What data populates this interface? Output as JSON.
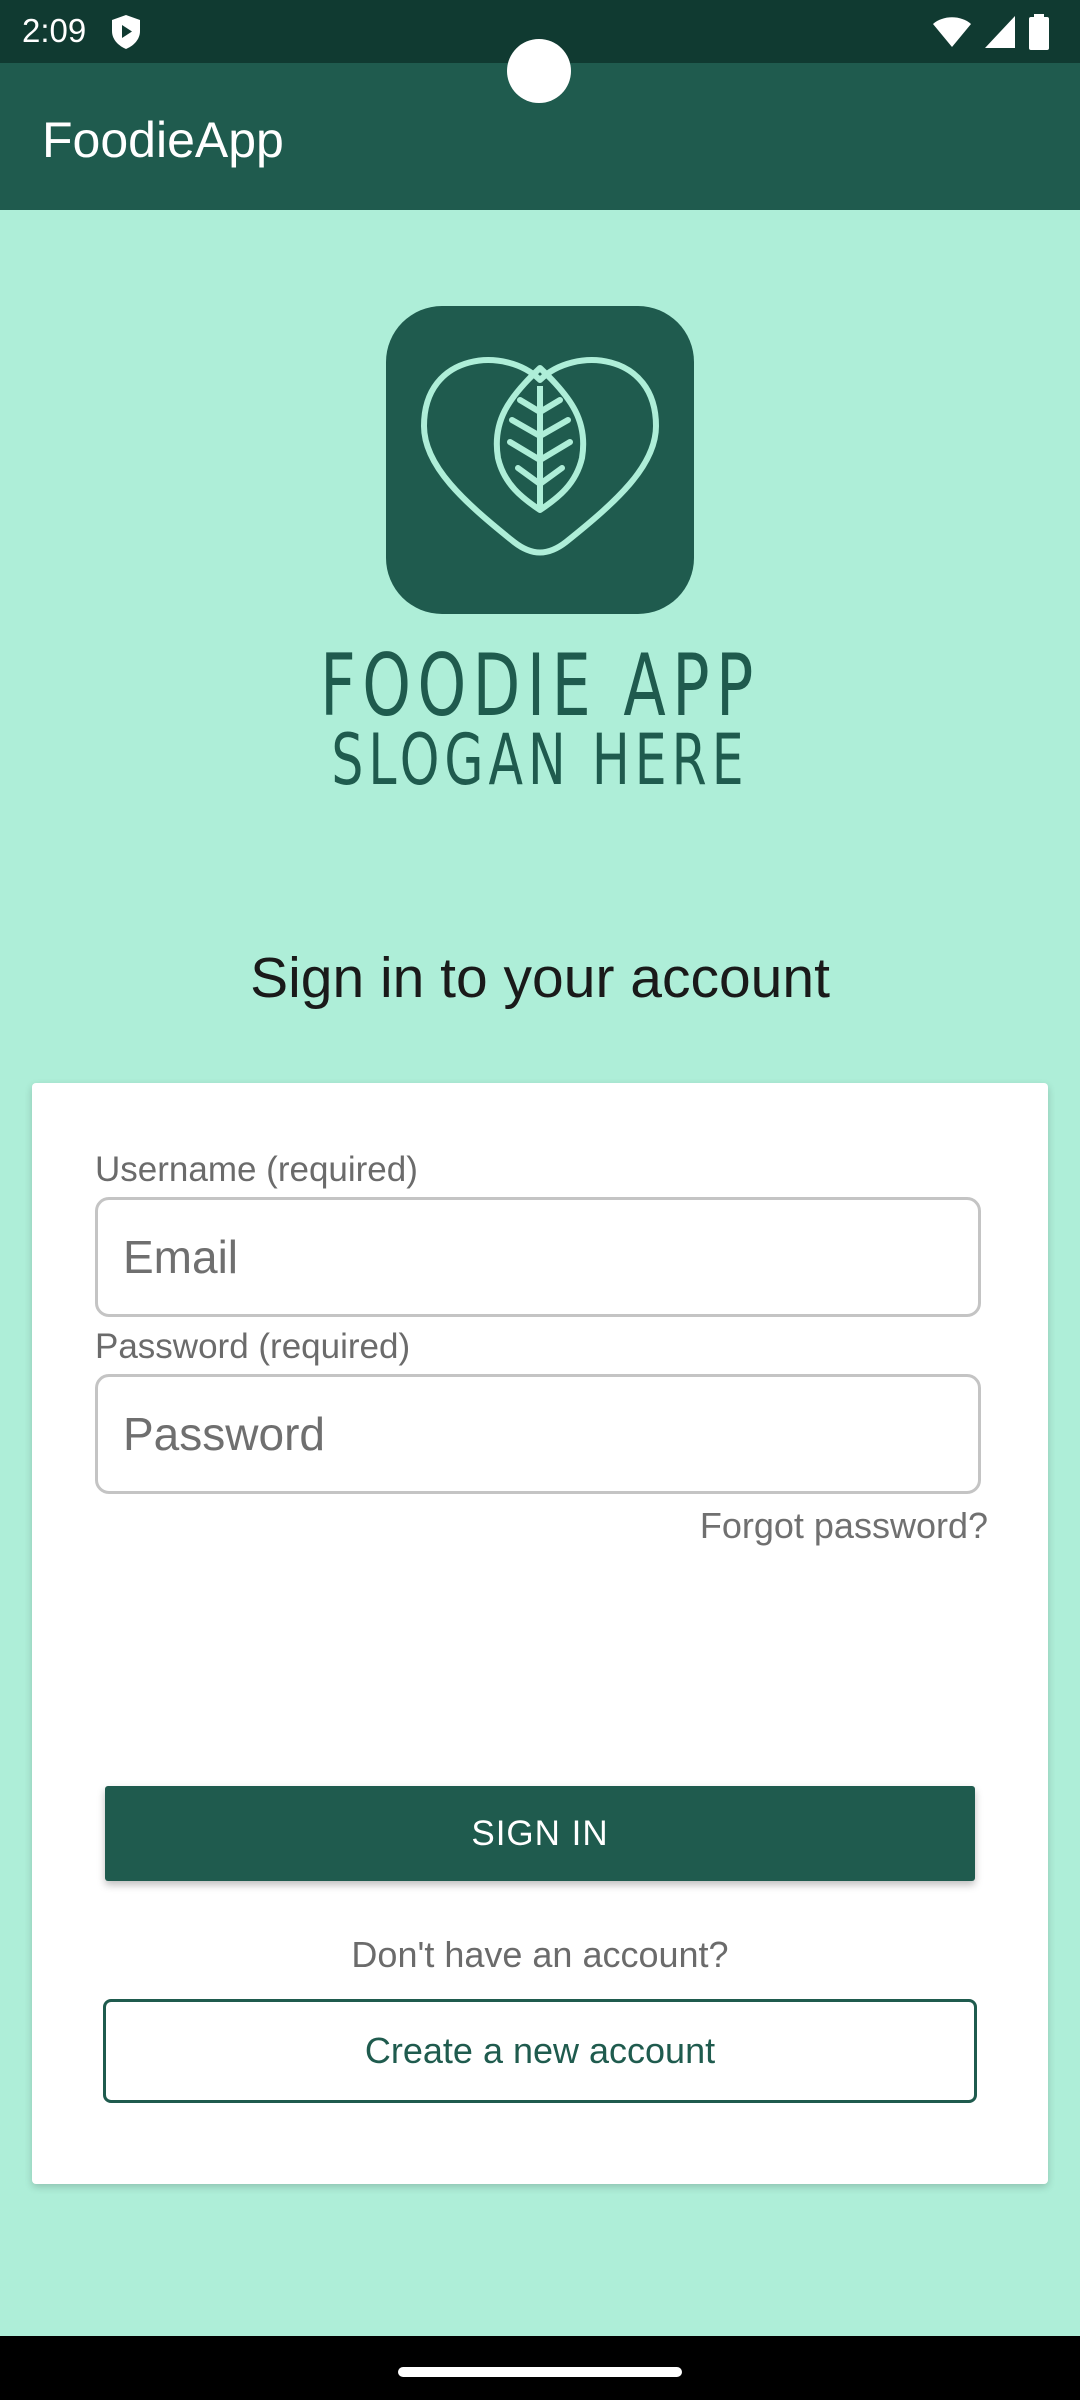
{
  "status_bar": {
    "time": "2:09",
    "icons": [
      "shield-icon",
      "wifi-icon",
      "signal-icon",
      "battery-icon"
    ]
  },
  "app_bar": {
    "title": "FoodieApp"
  },
  "logo": {
    "title": "FOODIE APP",
    "slogan": "SLOGAN HERE",
    "icon": "heart-leaf-logo-icon"
  },
  "heading": "Sign in to your account",
  "form": {
    "username_label": "Username (required)",
    "username_placeholder": "Email",
    "username_value": "",
    "password_label": "Password (required)",
    "password_placeholder": "Password",
    "password_value": "",
    "forgot_link": "Forgot password?",
    "signin_button": "SIGN IN",
    "no_account_text": "Don't have an account?",
    "create_button": "Create a new account"
  },
  "colors": {
    "background": "#aeeed8",
    "primary": "#1f5b4e",
    "status_bar": "#103a31",
    "card": "#ffffff"
  }
}
